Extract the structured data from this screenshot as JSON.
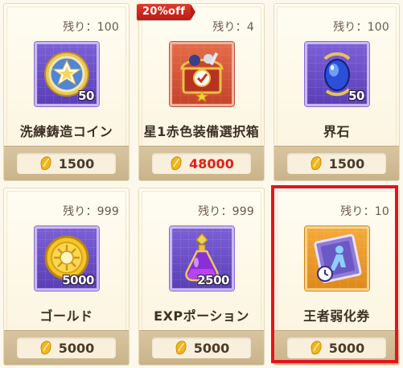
{
  "shop": {
    "items": [
      {
        "stock": "残り：100",
        "name": "洗練鋳造コイン",
        "qty": "50",
        "price": "1500",
        "icon": "star-medal-icon"
      },
      {
        "stock": "残り：4",
        "name": "星1赤色装備選択箱",
        "qty": "",
        "price": "48000",
        "icon": "treasure-box-icon",
        "badge": "20%off"
      },
      {
        "stock": "残り：100",
        "name": "界石",
        "qty": "50",
        "price": "1500",
        "icon": "blue-gem-icon"
      },
      {
        "stock": "残り：999",
        "name": "ゴールド",
        "qty": "5000",
        "price": "5000",
        "icon": "gold-coin-icon"
      },
      {
        "stock": "残り：999",
        "name": "EXPポーション",
        "qty": "2500",
        "price": "5000",
        "icon": "potion-icon"
      },
      {
        "stock": "残り：10",
        "name": "王者弱化券",
        "qty": "",
        "price": "5000",
        "icon": "ticket-icon"
      }
    ],
    "currency_icon": "gold-leaf-coin-icon"
  },
  "colors": {
    "highlight": "#e3141e",
    "discount_price": "#e0201a"
  }
}
